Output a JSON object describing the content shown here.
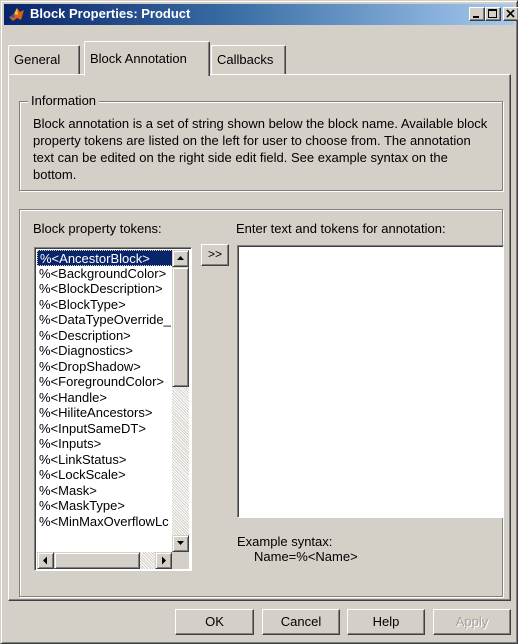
{
  "window": {
    "title": "Block Properties: Product",
    "controls": [
      "minimize-icon",
      "maximize-icon",
      "close-icon"
    ]
  },
  "tabs": [
    {
      "label": "General",
      "active": false
    },
    {
      "label": "Block Annotation",
      "active": true
    },
    {
      "label": "Callbacks",
      "active": false
    }
  ],
  "information": {
    "legend": "Information",
    "text": "Block annotation is a set of string shown below the block name. Available block property tokens are listed on the left for user to choose from. The annotation text can be edited on the right side edit field. See example syntax on the bottom."
  },
  "tokens": {
    "label": "Block property tokens:",
    "selected_index": 0,
    "items": [
      "%<AncestorBlock>",
      "%<BackgroundColor>",
      "%<BlockDescription>",
      "%<BlockType>",
      "%<DataTypeOverride_",
      "%<Description>",
      "%<Diagnostics>",
      "%<DropShadow>",
      "%<ForegroundColor>",
      "%<Handle>",
      "%<HiliteAncestors>",
      "%<InputSameDT>",
      "%<Inputs>",
      "%<LinkStatus>",
      "%<LockScale>",
      "%<Mask>",
      "%<MaskType>",
      "%<MinMaxOverflowLc"
    ]
  },
  "insert_button": ">>",
  "annotation": {
    "label": "Enter text and tokens for annotation:",
    "value": ""
  },
  "example": {
    "label": "Example syntax:",
    "value": "Name=%<Name>"
  },
  "buttons": {
    "ok": "OK",
    "cancel": "Cancel",
    "help": "Help",
    "apply": "Apply"
  },
  "colors": {
    "title_bar_start": "#0a246a",
    "title_bar_end": "#a6caf0",
    "face": "#d4d0c8",
    "selection": "#0a246a"
  }
}
